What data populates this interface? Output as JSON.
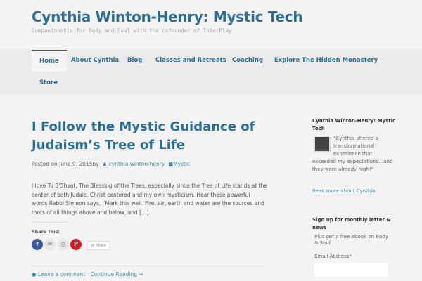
{
  "site": {
    "title": "Cynthia Winton-Henry: Mystic Tech",
    "tagline": "Companionship for Body and Soul with the cofounder of InterPlay"
  },
  "nav": [
    "Home",
    "About Cynthia",
    "Blog",
    "Classes and Retreats",
    "Coaching",
    "Explore The Hidden Monastery",
    "Store"
  ],
  "post": {
    "title": "I Follow the Mystic Guidance of Judaism’s Tree of Life",
    "posted_on": "Posted on",
    "date": "June 9, 2015",
    "by": "by",
    "author": "cynthia winton-henry",
    "category": "Mystic",
    "excerpt": "I love Tu B’Shvat, The Blessing of the Trees, especially since the Tree of Life stands at the center of both Judaic, Christ centered and my own mysticism.  Hear these powerful words  Rabbi Simeon says, “Mark this well. Fire, air, earth and water are the sources and roots of all things above and below, and […]",
    "share_label": "Share this:",
    "more": "More",
    "leave_comment": "Leave a comment",
    "sep": "·",
    "continue": "Continue Reading →"
  },
  "sidebar": {
    "widget1_title": "Cynthia Winton-Henry: Mystic Tech",
    "quote": "“Cynthia offered a transformational experience that exceeded my expectations…and they were already high!”",
    "read_more": "Read more about Cynthia",
    "widget2_title": "Sign up for monthly letter & news",
    "promo": "Plus get a free ebook on Body & Soul",
    "email_label": "Email Address",
    "required": "*"
  }
}
